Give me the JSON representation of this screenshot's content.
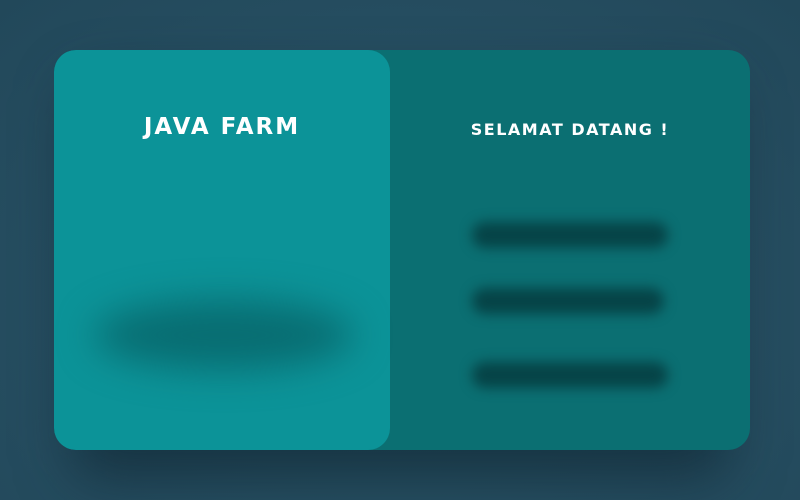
{
  "brand": {
    "title": "JAVA FARM"
  },
  "welcome": {
    "title": "SELAMAT DATANG !"
  },
  "colors": {
    "background": "#264e61",
    "card_right": "#0b6f72",
    "card_left": "#0c9398",
    "text": "#ffffff"
  }
}
